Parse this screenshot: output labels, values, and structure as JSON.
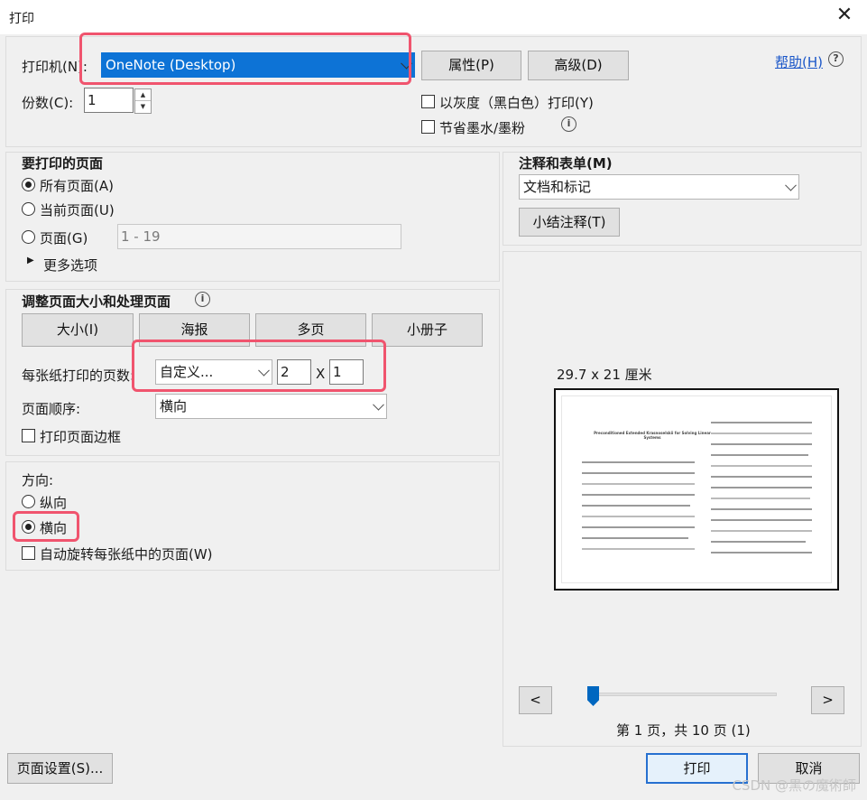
{
  "window": {
    "title": "打印",
    "close_glyph": "✕"
  },
  "printer": {
    "label": "打印机(N):",
    "selected": "OneNote (Desktop)",
    "properties_button": "属性(P)",
    "advanced_button": "高级(D)",
    "help_link": "帮助(H)",
    "help_glyph": "?",
    "copies_label": "份数(C):",
    "copies_value": "1",
    "grayscale_label": "以灰度（黑白色）打印(Y)",
    "save_ink_label": "节省墨水/墨粉",
    "info_glyph": "i"
  },
  "pages": {
    "heading": "要打印的页面",
    "all_pages": "所有页面(A)",
    "current_page": "当前页面(U)",
    "pages_option": "页面(G)",
    "pages_range": "1 - 19",
    "more_options": "更多选项"
  },
  "sizing": {
    "heading": "调整页面大小和处理页面",
    "tabs": [
      "大小(I)",
      "海报",
      "多页",
      "小册子"
    ],
    "pages_per_sheet_label": "每张纸打印的页数:",
    "pages_per_sheet_value": "自定义...",
    "cols": "2",
    "times_glyph": "X",
    "rows": "1",
    "page_order_label": "页面顺序:",
    "page_order_value": "横向",
    "print_border_label": "打印页面边框"
  },
  "orientation": {
    "heading": "方向:",
    "portrait": "纵向",
    "landscape": "横向",
    "auto_rotate": "自动旋转每张纸中的页面(W)"
  },
  "comments": {
    "heading": "注释和表单(M)",
    "value": "文档和标记",
    "summarize_button": "小结注释(T)"
  },
  "preview": {
    "size_label": "29.7 x 21 厘米",
    "prev_glyph": "<",
    "next_glyph": ">",
    "page_status": "第 1 页，共 10 页 (1)",
    "doc_title": "Preconditioned Extended Krasnoselskii for Solving Linear Systems",
    "slider_position": 0.0
  },
  "footer": {
    "page_setup_button": "页面设置(S)...",
    "print_button": "打印",
    "cancel_button": "取消",
    "watermark": "CSDN @黒の魔術師"
  },
  "colors": {
    "accent": "#0d73d6",
    "highlight": "#f0546e",
    "link": "#1a56c8"
  }
}
